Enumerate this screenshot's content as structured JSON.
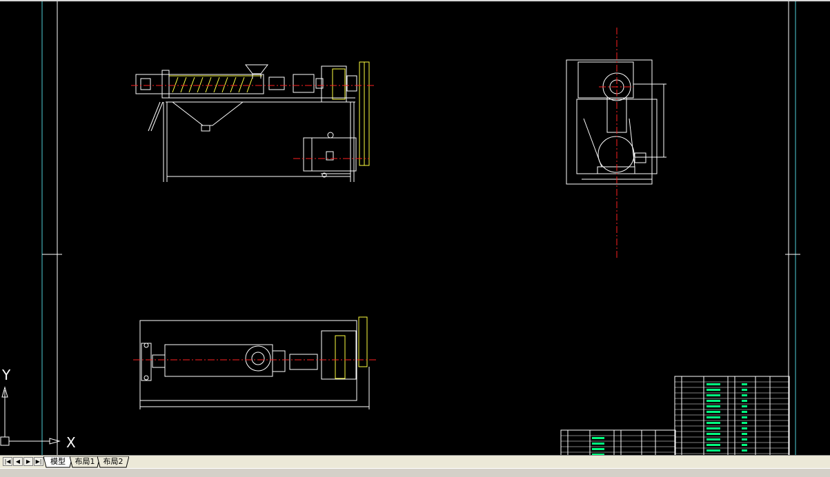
{
  "canvas": {
    "background": "#000000",
    "ucs": {
      "x_label": "X",
      "y_label": "Y"
    }
  },
  "tabs": [
    {
      "label": "模型",
      "active": true
    },
    {
      "label": "布局1",
      "active": false
    },
    {
      "label": "布局2",
      "active": false
    }
  ],
  "nav_buttons": [
    {
      "name": "first-layout-button",
      "glyph": "|◀"
    },
    {
      "name": "prev-layout-button",
      "glyph": "◀"
    },
    {
      "name": "next-layout-button",
      "glyph": "▶"
    },
    {
      "name": "last-layout-button",
      "glyph": "▶|"
    }
  ],
  "colors": {
    "frame": "#ffffff",
    "border": "#4fd0d8",
    "centerline": "#ff2020",
    "highlight": "#ffff40",
    "table": "#00ff80"
  }
}
